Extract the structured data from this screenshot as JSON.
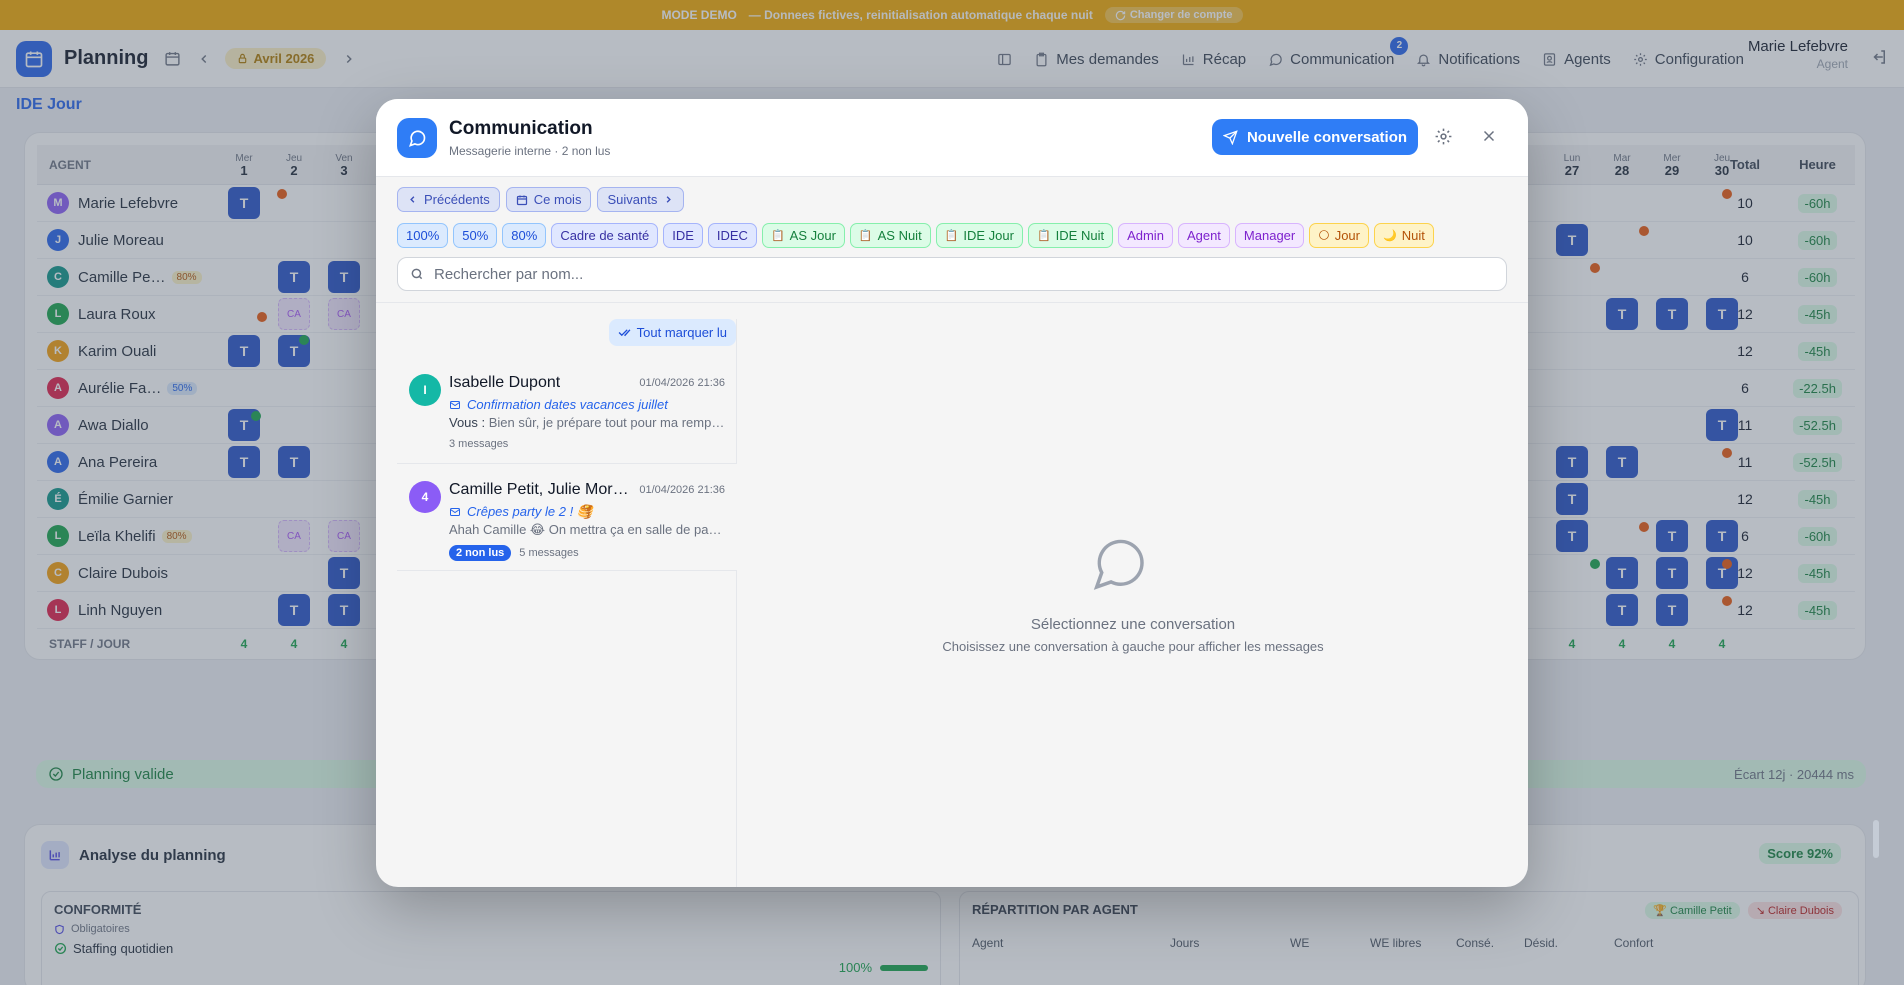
{
  "banner": {
    "mode": "MODE DEMO",
    "text": "— Donnees fictives, reinitialisation automatique chaque nuit",
    "switch_label": "Changer de compte"
  },
  "header": {
    "title": "Planning",
    "month": "Avril 2026",
    "nav": [
      {
        "label": "Mes demandes",
        "icon": "clipboard-icon"
      },
      {
        "label": "Récap",
        "icon": "bar-chart-icon"
      },
      {
        "label": "Communication",
        "icon": "chat-icon",
        "badge": "2"
      },
      {
        "label": "Notifications",
        "icon": "bell-icon"
      },
      {
        "label": "Agents",
        "icon": "id-card-icon"
      },
      {
        "label": "Configuration",
        "icon": "gear-icon"
      }
    ],
    "user_name": "Marie Lefebvre",
    "user_role": "Agent"
  },
  "section": "IDE Jour",
  "planning": {
    "col_agent": "AGENT",
    "col_total": "Total",
    "col_heure": "Heure",
    "days_left": [
      {
        "dow": "Mer",
        "num": "1"
      },
      {
        "dow": "Jeu",
        "num": "2"
      },
      {
        "dow": "Ven",
        "num": "3"
      }
    ],
    "days_right": [
      {
        "dow": "Lun",
        "num": "27"
      },
      {
        "dow": "Mar",
        "num": "28"
      },
      {
        "dow": "Mer",
        "num": "29"
      },
      {
        "dow": "Jeu",
        "num": "30"
      }
    ],
    "cell_t": "T",
    "cell_ca": "CA",
    "rows": [
      {
        "initial": "M",
        "name": "Marie Lefebvre",
        "color": "#8b5cf6",
        "total": "10",
        "heure": "-60h"
      },
      {
        "initial": "J",
        "name": "Julie Moreau",
        "color": "#2563eb",
        "total": "10",
        "heure": "-60h"
      },
      {
        "initial": "C",
        "name": "Camille Pe…",
        "color": "#0d9488",
        "pct": "80%",
        "total": "6",
        "heure": "-60h"
      },
      {
        "initial": "L",
        "name": "Laura Roux",
        "color": "#16a34a",
        "total": "12",
        "heure": "-45h"
      },
      {
        "initial": "K",
        "name": "Karim Ouali",
        "color": "#f59e0b",
        "total": "12",
        "heure": "-45h"
      },
      {
        "initial": "A",
        "name": "Aurélie Fa…",
        "color": "#e11d48",
        "pct": "50%",
        "total": "6",
        "heure": "-22.5h"
      },
      {
        "initial": "A",
        "name": "Awa Diallo",
        "color": "#8b5cf6",
        "total": "11",
        "heure": "-52.5h"
      },
      {
        "initial": "A",
        "name": "Ana Pereira",
        "color": "#2563eb",
        "total": "11",
        "heure": "-52.5h"
      },
      {
        "initial": "É",
        "name": "Émilie Garnier",
        "color": "#0d9488",
        "total": "12",
        "heure": "-45h"
      },
      {
        "initial": "L",
        "name": "Leïla Khelifi",
        "color": "#16a34a",
        "pct": "80%",
        "total": "6",
        "heure": "-60h"
      },
      {
        "initial": "C",
        "name": "Claire Dubois",
        "color": "#f59e0b",
        "total": "12",
        "heure": "-45h"
      },
      {
        "initial": "L",
        "name": "Linh Nguyen",
        "color": "#e11d48",
        "total": "12",
        "heure": "-45h"
      }
    ],
    "staff_label": "STAFF / JOUR",
    "staff_value": "4",
    "valid_label": "Planning valide",
    "valid_meta": "Écart 12j · 20444 ms"
  },
  "analysis": {
    "title": "Analyse du planning",
    "score": "Score 92%",
    "conformite": "CONFORMITÉ",
    "obligatoires": "Obligatoires",
    "staffing": "Staffing quotidien",
    "staffing_val": "100%",
    "repartition": "RÉPARTITION PAR AGENT",
    "best": "Camille Petit",
    "worst": "Claire Dubois",
    "cols": [
      "Agent",
      "Jours",
      "WE",
      "WE libres",
      "Consé.",
      "Désid.",
      "Confort"
    ]
  },
  "modal": {
    "title": "Communication",
    "subtitle": "Messagerie interne · 2 non lus",
    "new_button": "Nouvelle conversation",
    "nav_prev": "Précédents",
    "nav_month": "Ce mois",
    "nav_next": "Suivants",
    "filters": [
      {
        "label": "100%",
        "style": "c-blue"
      },
      {
        "label": "50%",
        "style": "c-blue"
      },
      {
        "label": "80%",
        "style": "c-blue"
      },
      {
        "label": "Cadre de santé",
        "style": "c-indigo"
      },
      {
        "label": "IDE",
        "style": "c-indigo"
      },
      {
        "label": "IDEC",
        "style": "c-indigo"
      },
      {
        "label": "AS Jour",
        "style": "c-green",
        "icon": "📋"
      },
      {
        "label": "AS Nuit",
        "style": "c-green",
        "icon": "📋"
      },
      {
        "label": "IDE Jour",
        "style": "c-green",
        "icon": "📋"
      },
      {
        "label": "IDE Nuit",
        "style": "c-green",
        "icon": "📋"
      },
      {
        "label": "Admin",
        "style": "c-purple"
      },
      {
        "label": "Agent",
        "style": "c-purple"
      },
      {
        "label": "Manager",
        "style": "c-purple"
      },
      {
        "label": "Jour",
        "style": "c-amber",
        "icon": "🌕"
      },
      {
        "label": "Nuit",
        "style": "c-amber",
        "icon": "🌙"
      }
    ],
    "search_placeholder": "Rechercher par nom...",
    "mark_all_read": "Tout marquer lu",
    "conversations": [
      {
        "initial": "I",
        "name": "Isabelle Dupont",
        "color": "#14b8a6",
        "date": "01/04/2026 21:36",
        "subject": "Confirmation dates vacances juillet",
        "preview_from": "Vous :",
        "preview": "Bien sûr, je prépare tout pour ma remplaçante",
        "count": "3 messages"
      },
      {
        "initial": "4",
        "name": "Camille Petit, Julie Moreau, Laura Roux",
        "color": "#8b5cf6",
        "date": "01/04/2026 21:36",
        "subject": "Crêpes party le 2 ! 🥞",
        "preview_from": "",
        "preview": "Ahah Camille 😂 On mettra ça en salle de pause !",
        "unread": "2 non lus",
        "count": "5 messages"
      }
    ],
    "empty_title": "Sélectionnez une conversation",
    "empty_sub": "Choisissez une conversation à gauche pour afficher les messages"
  }
}
